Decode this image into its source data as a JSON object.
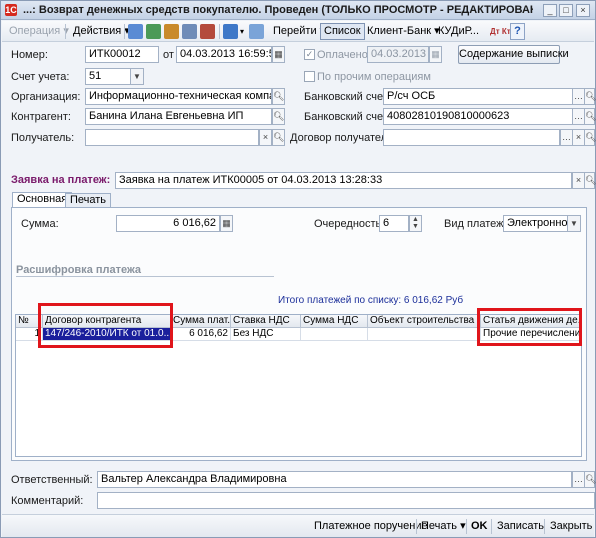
{
  "window": {
    "title": "...: Возврат денежных средств покупателю. Проведен (ТОЛЬКО ПРОСМОТР - РЕДАКТИРОВАНИЕ ...",
    "app_icon_text": "1C",
    "minimize": "_",
    "maximize": "□",
    "close": "×"
  },
  "toolbar": {
    "operation": "Операция ▾",
    "actions": "Действия ▾",
    "goto": "Перейти ▾",
    "list": "Список",
    "client_bank": "Клиент-Банк ▾",
    "kudir": "КУДиР...",
    "dtkt": "Дт Кт",
    "help": "?"
  },
  "form": {
    "number_label": "Номер:",
    "number_value": "ИТК00012",
    "date_from": "от",
    "date_value": "04.03.2013 16:59:59",
    "paid_label": "Оплачено:",
    "paid_date": "04.03.2013 16:...",
    "statement_button": "Содержание выписки",
    "account_label": "Счет учета:",
    "account_value": "51",
    "other_ops_label": "По прочим операциям",
    "org_label": "Организация:",
    "org_value": "Информационно-техническая компания ...",
    "bank_account_label1": "Банковский счет:",
    "bank_account_value1": "Р/сч ОСБ",
    "contractor_label": "Контрагент:",
    "contractor_value": "Банина Илана Евгеньевна ИП",
    "bank_account_label2": "Банковский счет:",
    "bank_account_value2": "40802810190810000623",
    "recipient_label": "Получатель:",
    "recipient_value": "",
    "recipient_contract_label": "Договор получател...",
    "recipient_contract_value": ""
  },
  "request": {
    "label": "Заявка на платеж:",
    "value": "Заявка на платеж ИТК00005 от 04.03.2013 13:28:33"
  },
  "tabs": {
    "main": "Основная",
    "print": "Печать"
  },
  "main_tab": {
    "sum_label": "Сумма:",
    "sum_value": "6 016,62",
    "priority_label": "Очередность:",
    "priority_value": "6",
    "payment_type_label": "Вид платежа:",
    "payment_type_value": "Электронно",
    "breakdown_title": "Расшифровка платежа",
    "total_text": "Итого платежей по списку: 6 016,62 Руб"
  },
  "table": {
    "headers": [
      "№",
      "Договор контрагента",
      "Сумма плат...",
      "Ставка НДС",
      "Сумма НДС",
      "Объект строительства",
      "Статья движения де..."
    ],
    "rows": [
      {
        "num": "1",
        "contract": "147/246-2010/ИТК от 01.0...",
        "sum": "6 016,62",
        "vat_rate": "Без НДС",
        "vat_sum": "",
        "object": "",
        "article": "Прочие перечисления"
      }
    ]
  },
  "bottom": {
    "responsible_label": "Ответственный:",
    "responsible_value": "Вальтер Александра Владимировна",
    "comment_label": "Комментарий:",
    "comment_value": ""
  },
  "footer": {
    "payment_order": "Платежное поручение",
    "print": "Печать ▾",
    "ok": "OK",
    "save": "Записать",
    "close": "Закрыть"
  },
  "colors": {
    "highlight_box": "#e0151b",
    "selected_cell": "#1a1f9c",
    "section_title": "#7a1a6b",
    "total_text": "#1c2f9a"
  }
}
